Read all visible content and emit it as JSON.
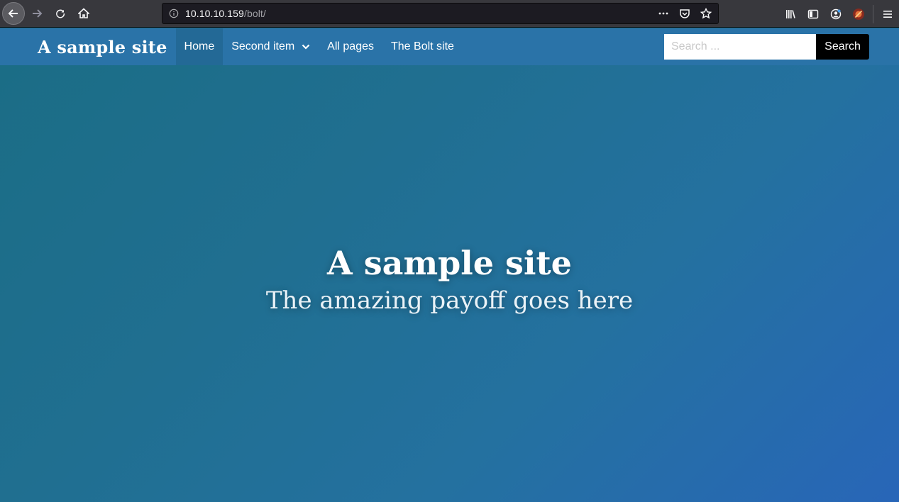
{
  "browser": {
    "url_host": "10.10.10.159",
    "url_path": "/bolt/",
    "icons": {
      "back": "back-arrow-icon",
      "forward": "forward-arrow-icon",
      "reload": "reload-icon",
      "home": "home-icon",
      "info": "info-icon",
      "more": "more-dots-icon",
      "pocket": "pocket-icon",
      "bookmark": "star-icon",
      "library": "library-icon",
      "sidebar": "sidebar-icon",
      "account": "account-icon",
      "extension": "extension-icon",
      "menu": "hamburger-menu-icon"
    }
  },
  "site": {
    "brand": "A sample site",
    "menu": [
      {
        "label": "Home",
        "active": true
      },
      {
        "label": "Second item",
        "has_dropdown": true
      },
      {
        "label": "All pages"
      },
      {
        "label": "The Bolt site"
      }
    ],
    "search": {
      "placeholder": "Search ...",
      "button_label": "Search"
    },
    "colors": {
      "navbar": "#2a73a8",
      "active_item": "#236996",
      "search_button": "#000000"
    }
  },
  "hero": {
    "title": "A sample site",
    "subtitle": "The amazing payoff goes here"
  }
}
